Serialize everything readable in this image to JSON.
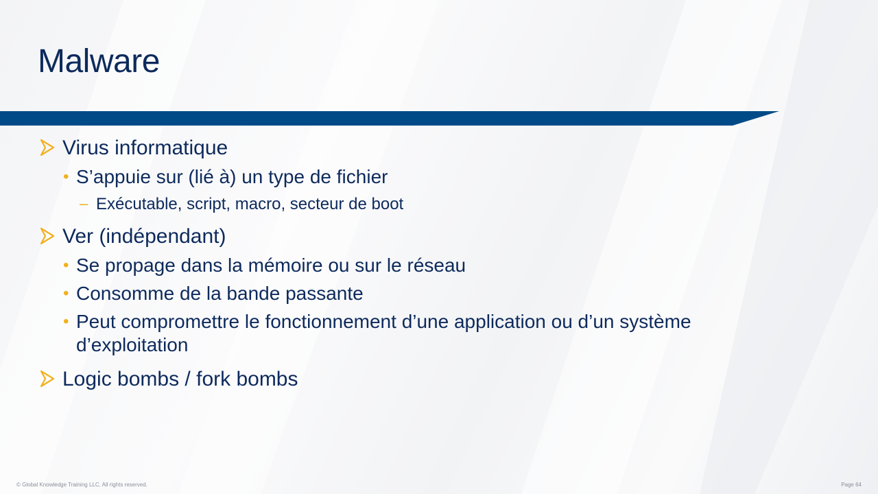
{
  "slide": {
    "title": "Malware",
    "items": [
      {
        "text": "Virus informatique",
        "children": [
          {
            "text": "S’appuie sur (lié à) un type de fichier",
            "children": [
              {
                "text": "Exécutable, script, macro, secteur de boot"
              }
            ]
          }
        ]
      },
      {
        "text": "Ver (indépendant)",
        "children": [
          {
            "text": "Se propage dans la mémoire ou sur le réseau"
          },
          {
            "text": "Consomme de la bande passante"
          },
          {
            "text": "Peut compromettre le fonctionnement d’une application ou d’un système d’exploitation"
          }
        ]
      },
      {
        "text": "Logic bombs / fork bombs"
      }
    ]
  },
  "footer": {
    "copyright": "© Global Knowledge Training LLC. All rights reserved.",
    "page": "Page 64"
  },
  "colors": {
    "title": "#0d2a5c",
    "band": "#004b87",
    "accent": "#f2b01e"
  },
  "icons": {
    "level1_marker": "arrow-bullet-icon",
    "level2_marker": "bullet-dot",
    "level3_marker": "dash"
  }
}
